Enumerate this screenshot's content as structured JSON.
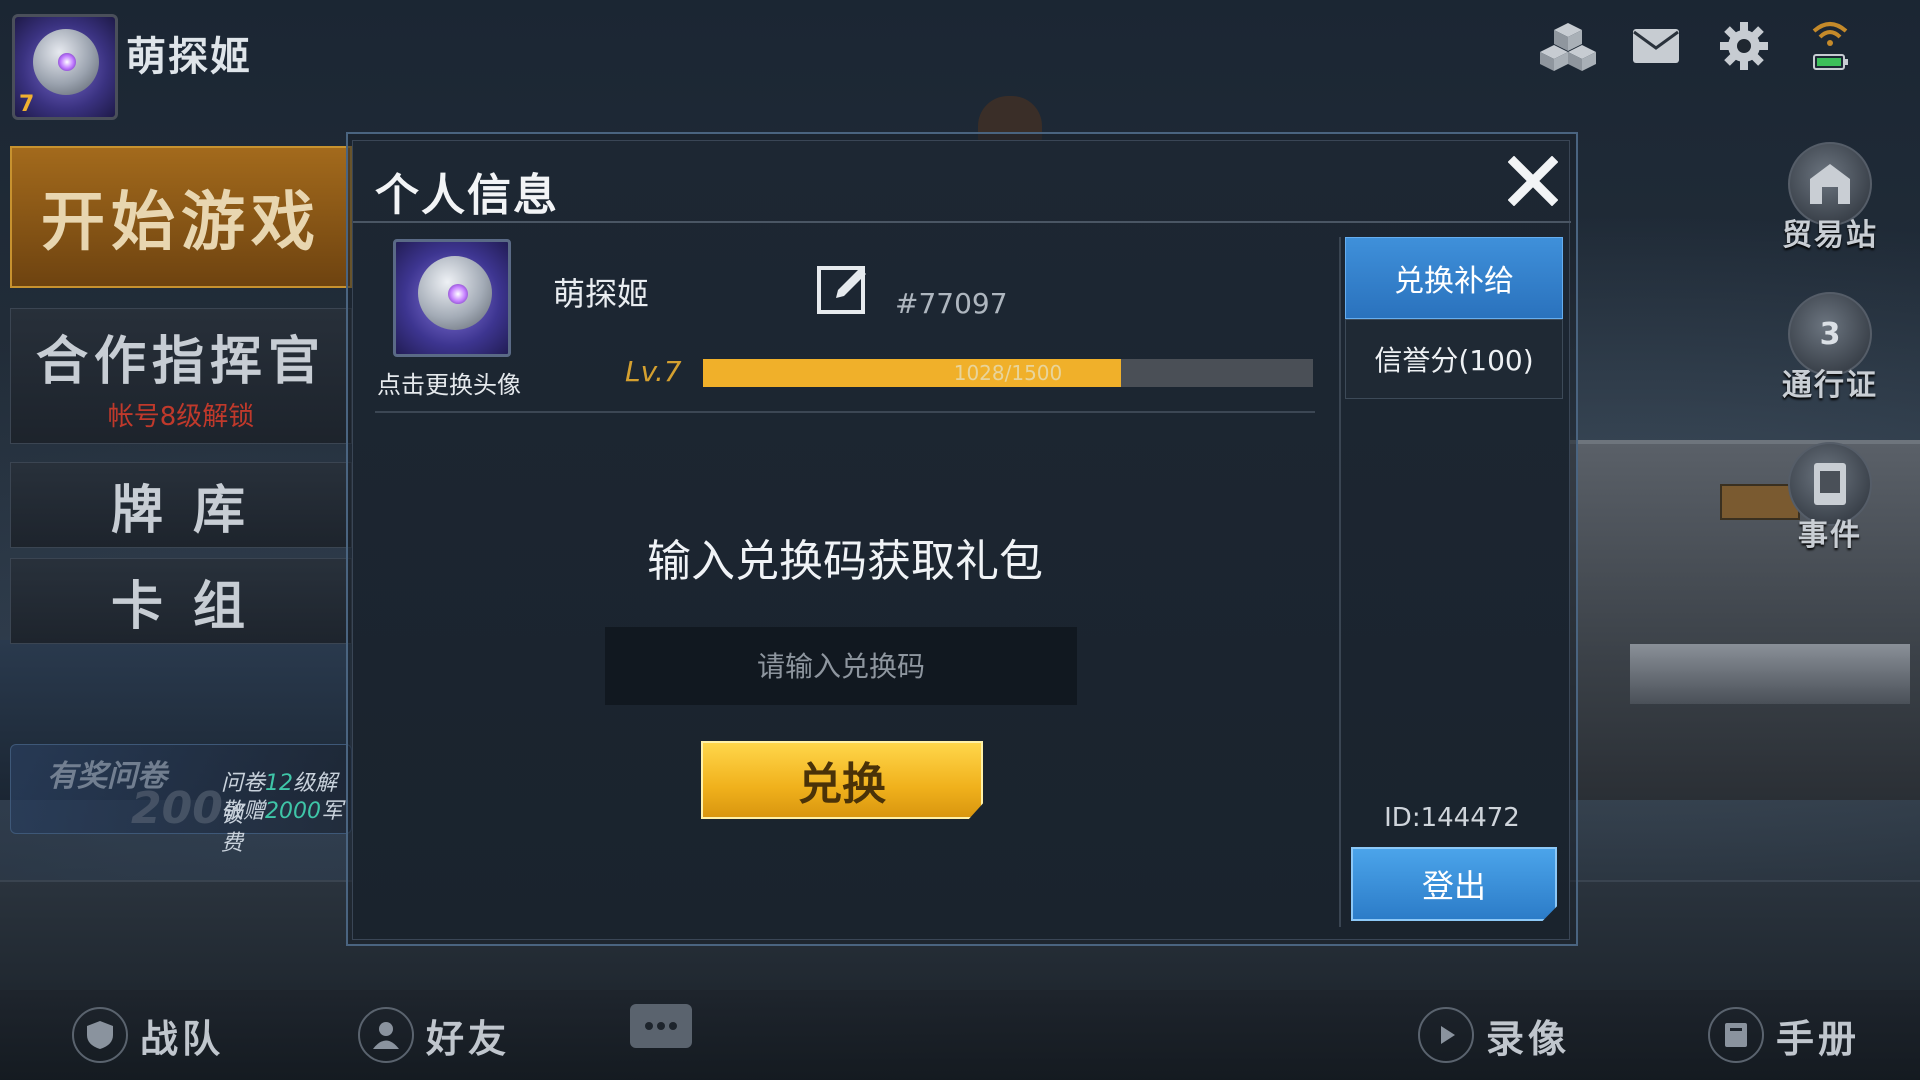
{
  "topbar": {
    "player_name": "萌探姬",
    "player_level": "7",
    "icons": [
      "cubes-icon",
      "mail-icon",
      "gear-icon",
      "wifi-battery-icon"
    ]
  },
  "left_menu": {
    "start_game": "开始游戏",
    "coop_commander": "合作指挥官",
    "coop_lock_hint": "帐号8级解锁",
    "card_library": "牌 库",
    "card_deck": "卡 组",
    "survey": {
      "title": "有奖问卷",
      "reward_number": "200",
      "line1_prefix": "问卷",
      "line1_highlight": "12",
      "line1_suffix": "级解锁",
      "line2_prefix": "敬赠",
      "line2_highlight": "2000",
      "line2_suffix": "军费"
    }
  },
  "right_side": {
    "trade_station": "贸易站",
    "pass": "通行证",
    "pass_level": "3",
    "event": "事件"
  },
  "bottombar": {
    "team": "战队",
    "friends": "好友",
    "replay": "录像",
    "handbook": "手册"
  },
  "modal": {
    "title": "个人信息",
    "avatar_hint": "点击更换头像",
    "profile_name": "萌探姬",
    "player_code": "#77097",
    "level_label": "Lv.7",
    "xp_text": "1028/1500",
    "xp_fraction": 0.6853,
    "redeem_heading": "输入兑换码获取礼包",
    "redeem_placeholder": "请输入兑换码",
    "redeem_button": "兑换",
    "tab_redeem": "兑换补给",
    "tab_credit": "信誉分(100)",
    "user_id": "ID:144472",
    "logout_button": "登出"
  },
  "colors": {
    "accent_gold": "#f0b02a",
    "accent_blue": "#2f7fcc",
    "lock_red": "#c0392b"
  }
}
